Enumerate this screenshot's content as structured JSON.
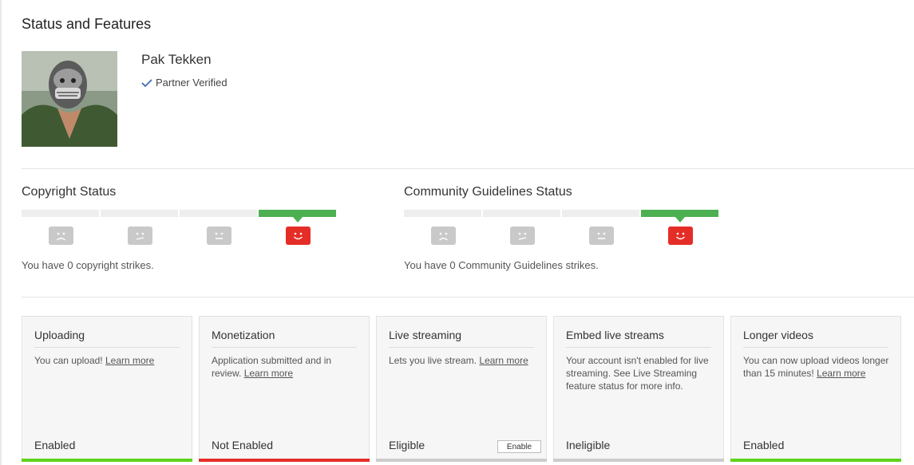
{
  "page": {
    "title": "Status and Features"
  },
  "channel": {
    "name": "Pak Tekken",
    "verified_label": "Partner Verified"
  },
  "copyright": {
    "title": "Copyright Status",
    "strike_text": "You have 0 copyright strikes.",
    "strikes": 0,
    "faces": [
      "frown-face-icon",
      "meh-face-icon",
      "neutral-face-icon",
      "smile-face-icon"
    ]
  },
  "community": {
    "title": "Community Guidelines Status",
    "strike_text": "You have 0 Community Guidelines strikes.",
    "strikes": 0,
    "faces": [
      "frown-face-icon",
      "meh-face-icon",
      "neutral-face-icon",
      "smile-face-icon"
    ]
  },
  "features": [
    {
      "title": "Uploading",
      "desc": "You can upload!",
      "link": "Learn more",
      "status": "Enabled",
      "bar_color": "#5fd31d"
    },
    {
      "title": "Monetization",
      "desc": "Application submitted and in review.",
      "link": "Learn more",
      "status": "Not Enabled",
      "bar_color": "#e52d27"
    },
    {
      "title": "Live streaming",
      "desc": "Lets you live stream.",
      "link": "Learn more",
      "status": "Eligible",
      "bar_color": "#cccccc",
      "button": "Enable"
    },
    {
      "title": "Embed live streams",
      "desc": "Your account isn't enabled for live streaming. See Live Streaming feature status for more info.",
      "link": "",
      "status": "Ineligible",
      "bar_color": "#cccccc"
    },
    {
      "title": "Longer videos",
      "desc": "You can now upload videos longer than 15 minutes!",
      "link": "Learn more",
      "status": "Enabled",
      "bar_color": "#5fd31d"
    }
  ],
  "colors": {
    "active_strike": "#4caf50",
    "youtube_red": "#e52d27",
    "face_gray": "#c9c9c9"
  }
}
